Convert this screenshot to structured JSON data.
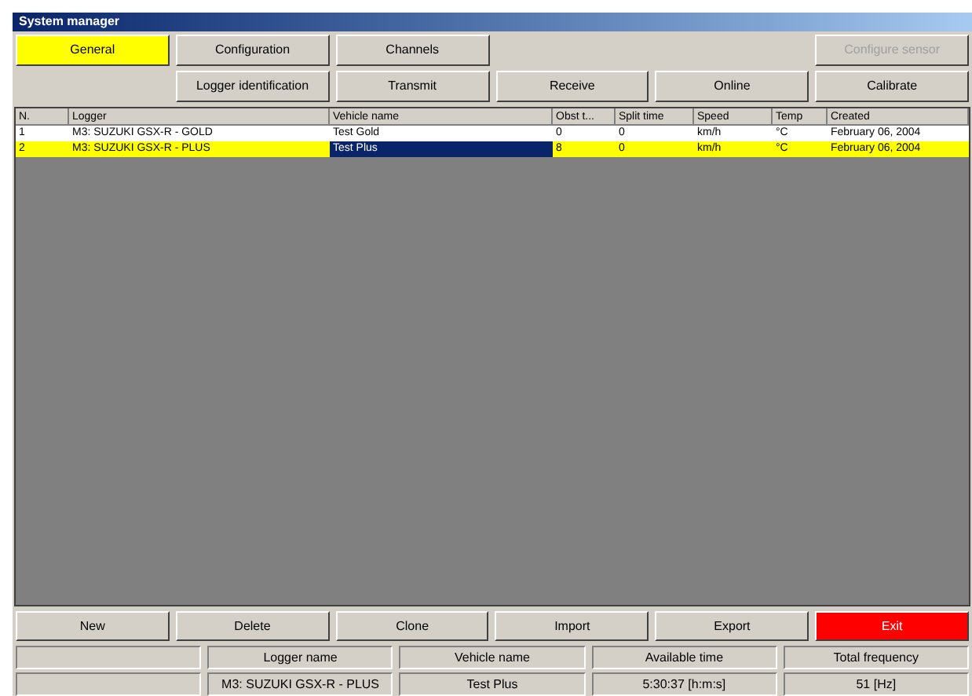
{
  "window": {
    "title": "System manager"
  },
  "toolbar_row_1": [
    {
      "label": "General",
      "selected": true,
      "disabled": false
    },
    {
      "label": "Configuration",
      "selected": false,
      "disabled": false
    },
    {
      "label": "Channels",
      "selected": false,
      "disabled": false
    },
    {
      "label": "Configure sensor",
      "selected": false,
      "disabled": true
    }
  ],
  "toolbar_row_2": [
    {
      "label": "Logger identification",
      "selected": false,
      "disabled": false
    },
    {
      "label": "Transmit",
      "selected": false,
      "disabled": false
    },
    {
      "label": "Receive",
      "selected": false,
      "disabled": false
    },
    {
      "label": "Online",
      "selected": false,
      "disabled": false
    },
    {
      "label": "Calibrate",
      "selected": false,
      "disabled": false
    }
  ],
  "table": {
    "columns": [
      "N.",
      "Logger",
      "Vehicle name",
      "Obst t...",
      "Split time",
      "Speed",
      "Temp",
      "Created"
    ],
    "rows": [
      {
        "selected": false,
        "cells": [
          "1",
          "M3: SUZUKI GSX-R - GOLD",
          "Test Gold",
          "0",
          "0",
          "km/h",
          "°C",
          "February 06, 2004"
        ]
      },
      {
        "selected": true,
        "cells": [
          "2",
          "M3: SUZUKI GSX-R - PLUS",
          "Test Plus",
          "8",
          "0",
          "km/h",
          "°C",
          "February 06, 2004"
        ]
      }
    ]
  },
  "buttons": [
    {
      "label": "New",
      "kind": "normal"
    },
    {
      "label": "Delete",
      "kind": "normal"
    },
    {
      "label": "Clone",
      "kind": "normal"
    },
    {
      "label": "Import",
      "kind": "normal"
    },
    {
      "label": "Export",
      "kind": "normal"
    },
    {
      "label": "Exit",
      "kind": "danger"
    }
  ],
  "info": {
    "labels": [
      "Logger name",
      "Vehicle name",
      "Available time",
      "Total frequency"
    ],
    "values": [
      "M3: SUZUKI GSX-R - PLUS",
      "Test Plus",
      "5:30:37 [h:m:s]",
      "51 [Hz]"
    ]
  }
}
